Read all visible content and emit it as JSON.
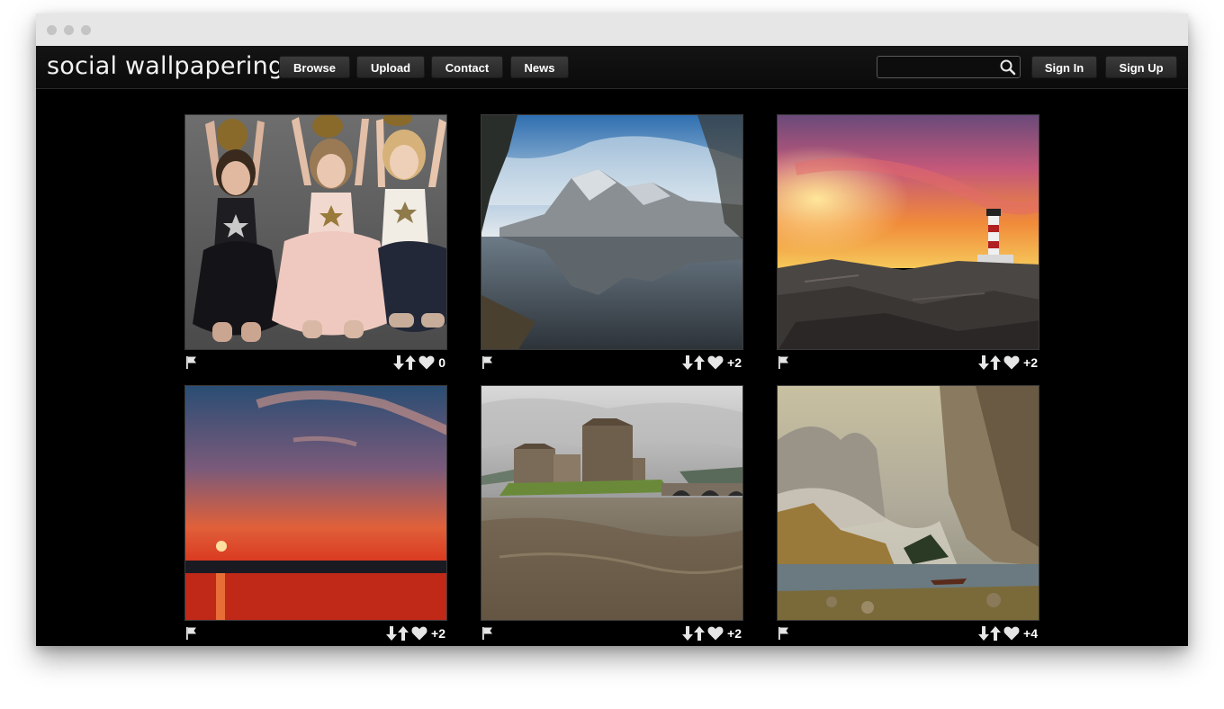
{
  "app": {
    "logo": "social wallpapering"
  },
  "nav": {
    "browse": "Browse",
    "upload": "Upload",
    "contact": "Contact",
    "news": "News"
  },
  "search": {
    "value": "",
    "icon": "search-icon"
  },
  "auth": {
    "sign_in": "Sign In",
    "sign_up": "Sign Up"
  },
  "wallpapers": [
    {
      "subject": "three girls with pineapples",
      "score": "0"
    },
    {
      "subject": "mountain lake reflection",
      "score": "+2"
    },
    {
      "subject": "lighthouse at sunset",
      "score": "+2"
    },
    {
      "subject": "red sunset over sea",
      "score": "+2"
    },
    {
      "subject": "castle on a lake",
      "score": "+2"
    },
    {
      "subject": "misty cliffs with canoe",
      "score": "+4"
    }
  ],
  "icons": {
    "flag": "flag-icon",
    "down": "arrow-down-icon",
    "up": "arrow-up-icon",
    "like": "heart-icon"
  },
  "colors": {
    "background": "#000000",
    "navbar": "#111111",
    "button": "#2f2f2f",
    "text": "#ffffff"
  }
}
